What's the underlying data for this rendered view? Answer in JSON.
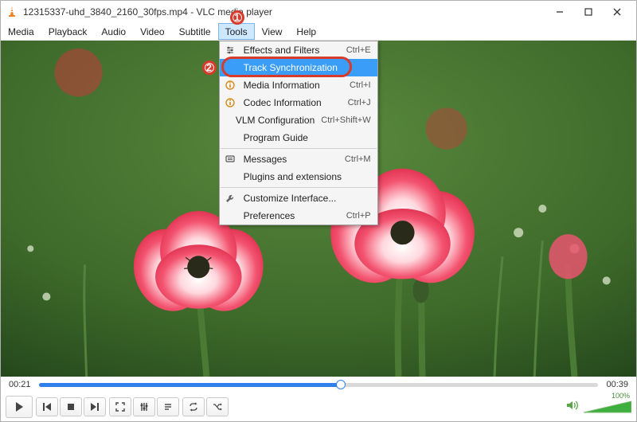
{
  "titlebar": {
    "filename": "12315337-uhd_3840_2160_30fps.mp4",
    "appname": "VLC media player",
    "separator": " - "
  },
  "menubar": {
    "items": [
      "Media",
      "Playback",
      "Audio",
      "Video",
      "Subtitle",
      "Tools",
      "View",
      "Help"
    ],
    "openIndex": 5
  },
  "dropdown": {
    "items": [
      {
        "icon": "sliders",
        "label": "Effects and Filters",
        "shortcut": "Ctrl+E"
      },
      {
        "icon": "",
        "label": "Track Synchronization",
        "shortcut": "",
        "highlight": true
      },
      {
        "icon": "info",
        "label": "Media Information",
        "shortcut": "Ctrl+I"
      },
      {
        "icon": "info",
        "label": "Codec Information",
        "shortcut": "Ctrl+J"
      },
      {
        "icon": "",
        "label": "VLM Configuration",
        "shortcut": "Ctrl+Shift+W"
      },
      {
        "icon": "",
        "label": "Program Guide",
        "shortcut": ""
      },
      {
        "sep": true
      },
      {
        "icon": "msg",
        "label": "Messages",
        "shortcut": "Ctrl+M"
      },
      {
        "icon": "",
        "label": "Plugins and extensions",
        "shortcut": ""
      },
      {
        "sep": true
      },
      {
        "icon": "wrench",
        "label": "Customize Interface...",
        "shortcut": ""
      },
      {
        "icon": "",
        "label": "Preferences",
        "shortcut": "Ctrl+P"
      }
    ]
  },
  "annotations": {
    "one": "1",
    "two": "2"
  },
  "playback": {
    "current": "00:21",
    "total": "00:39",
    "progress_percent": 54
  },
  "volume": {
    "label": "100%"
  }
}
